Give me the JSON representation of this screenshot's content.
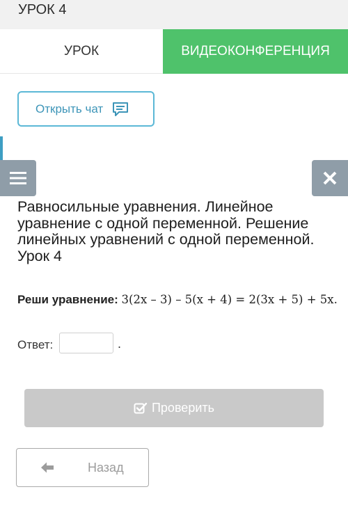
{
  "header": {
    "title": "УРОК 4"
  },
  "tabs": [
    {
      "label": "УРОК",
      "active": true
    },
    {
      "label": "ВИДЕОКОНФЕРЕНЦИЯ",
      "active": false
    }
  ],
  "chat": {
    "label": "Открыть чат",
    "icon": "chat-icon"
  },
  "sidebar": {
    "menu_icon": "hamburger-icon",
    "close_icon": "close-icon"
  },
  "lesson": {
    "heading": "Равносильные уравнения. Линейное уравнение с одной переменной. Решение линейных уравнений с одной переменной. Урок 4"
  },
  "task": {
    "prompt": "Реши уравнение:",
    "equation": "3(2x – 3) – 5(x + 4) = 2(3x + 5) + 5x."
  },
  "answer": {
    "label": "Ответ:",
    "value": "",
    "suffix": "."
  },
  "check_button": {
    "label": "Проверить",
    "icon": "checkbox-icon"
  },
  "back_button": {
    "label": "Назад",
    "icon": "arrow-left-icon"
  },
  "colors": {
    "accent_green": "#4fc26b",
    "accent_blue": "#5bb8d6",
    "panel_gray": "#8f9da8",
    "disabled_gray": "#c9c9c9"
  }
}
